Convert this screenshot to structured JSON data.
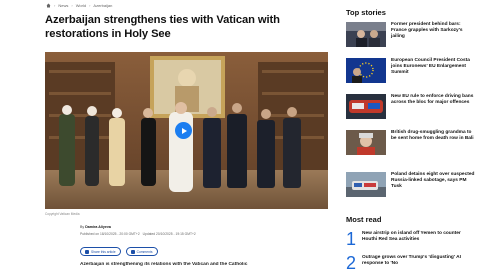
{
  "breadcrumb": {
    "items": [
      "News",
      "World",
      "Azerbaijan"
    ]
  },
  "article": {
    "title": "Azerbaijan strengthens ties with Vatican with restorations in Holy See",
    "image_caption": "Copyright Vatican Media",
    "author_prefix": "By",
    "author": "Damira Aliyeva",
    "published": "Published on 18/10/2025 - 20:00 GMT+2",
    "updated": "Updated 20/10/2025 - 19:15 GMT+2",
    "share_label": "Share this article",
    "comments_label": "Comments",
    "lead": "Azerbaijan is strengthening its relations with the Vatican and the Catholic"
  },
  "sidebar": {
    "top_stories_heading": "Top stories",
    "top_stories": [
      {
        "title": "Former president behind bars: France grapples with Sarkozy's jailing"
      },
      {
        "title": "European Council President Costa joins Euronews' EU Enlargement Summit"
      },
      {
        "title": "New EU rule to enforce driving bans across the bloc for major offences"
      },
      {
        "title": "British drug-smuggling grandma to be sent home from death row in Bali"
      },
      {
        "title": "Poland detains eight over suspected Russia-linked sabotage, says PM Tusk"
      }
    ],
    "most_read_heading": "Most read",
    "most_read": [
      {
        "num": "1",
        "title": "New airstrip on island off Yemen to counter Houthi Red Sea activities"
      },
      {
        "num": "2",
        "title": "Outrage grows over Trump's 'disgusting' AI response to 'No"
      }
    ]
  },
  "colors": {
    "accent": "#1c68d6",
    "play": "#1c7ef0",
    "text": "#111111"
  },
  "icons": {
    "home": "home-icon",
    "play": "play-icon",
    "share": "share-icon",
    "comments": "comment-icon"
  }
}
